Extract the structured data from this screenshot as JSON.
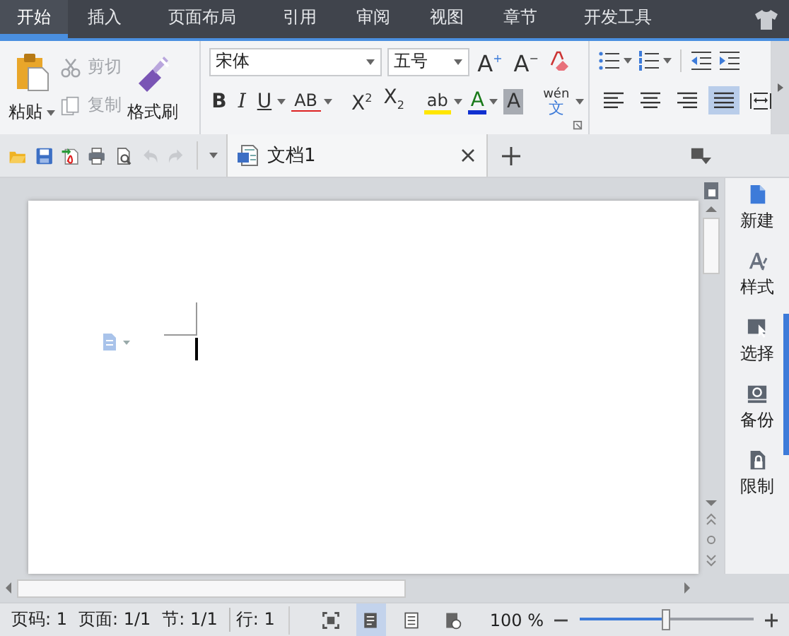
{
  "menu_tabs": [
    {
      "label": "开始",
      "selected": true
    },
    {
      "label": "插入",
      "selected": false
    },
    {
      "label": "页面布局",
      "selected": false
    },
    {
      "label": "引用",
      "selected": false
    },
    {
      "label": "审阅",
      "selected": false
    },
    {
      "label": "视图",
      "selected": false
    },
    {
      "label": "章节",
      "selected": false
    },
    {
      "label": "开发工具",
      "selected": false
    }
  ],
  "ribbon": {
    "paste": {
      "label": "粘贴"
    },
    "cut": {
      "label": "剪切",
      "disabled": true
    },
    "copy": {
      "label": "复制",
      "disabled": true
    },
    "format_painter": {
      "label": "格式刷"
    },
    "font_name": "宋体",
    "font_size": "五号",
    "size_buttons": [
      {
        "kind": "grow",
        "label": "A$^{+}$"
      },
      {
        "kind": "shrink",
        "label": "A$^{−}$"
      }
    ],
    "format_buttons": [
      {
        "kind": "bold",
        "label": "B"
      },
      {
        "kind": "italic",
        "label": "I"
      },
      {
        "kind": "underline",
        "label": "U"
      },
      {
        "kind": "strike",
        "label": "AB"
      },
      {
        "kind": "sup",
        "label": "X$^{2}$"
      },
      {
        "kind": "sub",
        "label": "X$_{2}$"
      },
      {
        "kind": "highlight",
        "label": "ab"
      },
      {
        "kind": "color",
        "label": "A"
      },
      {
        "kind": "shade",
        "label": "A"
      },
      {
        "kind": "pinyin",
        "label": "wén",
        "sub": "文"
      }
    ],
    "align_buttons": [
      {
        "kind": "left",
        "selected": false
      },
      {
        "kind": "center",
        "selected": false
      },
      {
        "kind": "right",
        "selected": false
      },
      {
        "kind": "justify",
        "selected": true
      },
      {
        "kind": "distributed",
        "selected": false
      }
    ]
  },
  "quick_access": [
    {
      "kind": "open",
      "disabled": false
    },
    {
      "kind": "save",
      "disabled": false
    },
    {
      "kind": "pdf",
      "disabled": false
    },
    {
      "kind": "print",
      "disabled": false
    },
    {
      "kind": "preview",
      "disabled": false
    },
    {
      "kind": "undo",
      "disabled": true
    },
    {
      "kind": "redo",
      "disabled": true
    }
  ],
  "doc_tab": {
    "title": "文档1"
  },
  "sidebar": [
    {
      "kind": "new",
      "label": "新建"
    },
    {
      "kind": "style",
      "label": "样式"
    },
    {
      "kind": "select",
      "label": "选择"
    },
    {
      "kind": "backup",
      "label": "备份"
    },
    {
      "kind": "restrict",
      "label": "限制"
    }
  ],
  "status": {
    "items": [
      "页码: 1",
      "页面: 1/1",
      "节: 1/1",
      "行: 1"
    ],
    "views": [
      {
        "kind": "fullscreen",
        "selected": false
      },
      {
        "kind": "page",
        "selected": true
      },
      {
        "kind": "outline",
        "selected": false
      },
      {
        "kind": "web",
        "selected": false
      }
    ],
    "zoom": "100 %",
    "zoom_slider": {
      "level": 0.5
    }
  }
}
